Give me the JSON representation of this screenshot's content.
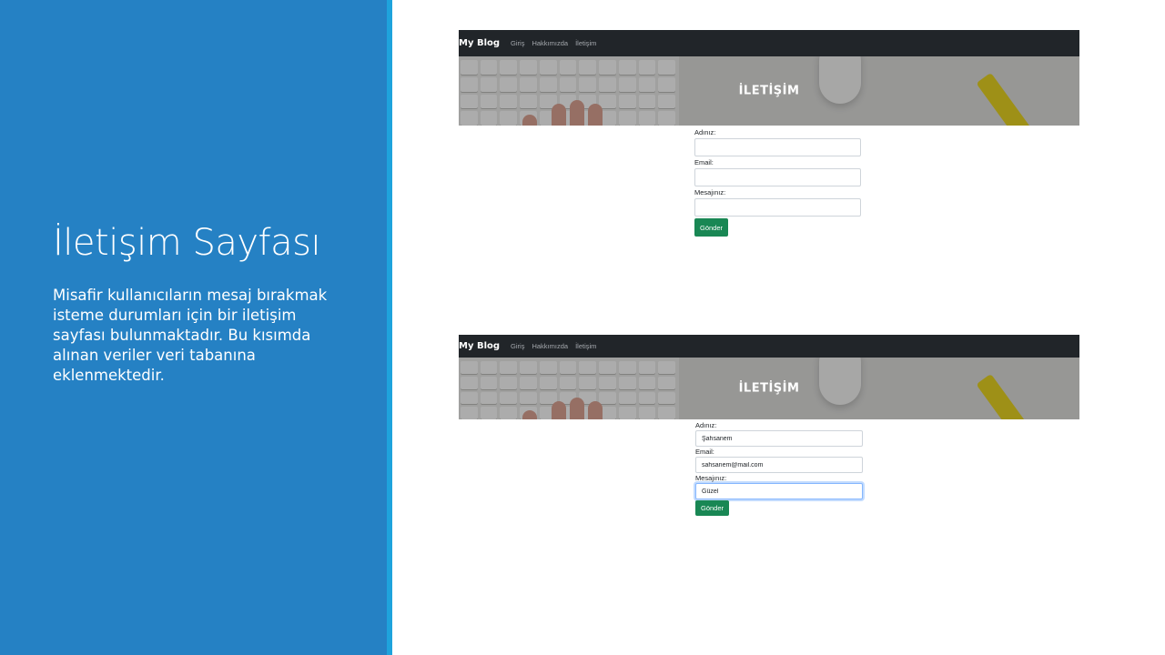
{
  "slide": {
    "title": "İletişim Sayfası",
    "body": "Misafir kullanıcıların mesaj bırakmak isteme durumları için bir iletişim sayfası bulunmaktadır. Bu kısımda alınan veriler veri tabanına eklenmektedir."
  },
  "colors": {
    "panel": "#2581c4",
    "accent": "#1ea3dc",
    "navbar": "#212529",
    "button": "#198754"
  },
  "screenshots": [
    {
      "navbar": {
        "brand": "My Blog",
        "links": [
          "Giriş",
          "Hakkımızda",
          "İletişim"
        ]
      },
      "hero_title": "İLETİŞİM",
      "form": {
        "name_label": "Adınız:",
        "name_value": "",
        "email_label": "Email:",
        "email_value": "",
        "message_label": "Mesajınız:",
        "message_value": "",
        "submit_label": "Gönder"
      }
    },
    {
      "navbar": {
        "brand": "My Blog",
        "links": [
          "Giriş",
          "Hakkımızda",
          "İletişim"
        ]
      },
      "hero_title": "İLETİŞİM",
      "form": {
        "name_label": "Adınız:",
        "name_value": "Şahsanem",
        "email_label": "Email:",
        "email_value": "sahsanem@mail.com",
        "message_label": "Mesajınız:",
        "message_value": "Güzel",
        "submit_label": "Gönder"
      }
    }
  ]
}
